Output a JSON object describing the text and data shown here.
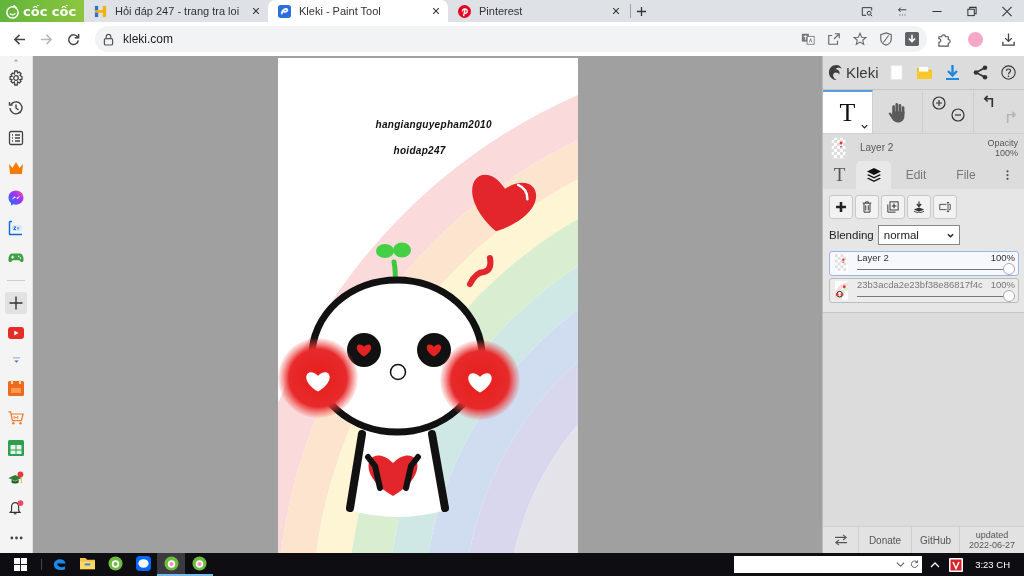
{
  "browser": {
    "logo": "cốc cốc",
    "tabs": [
      {
        "kind": "hoidap",
        "title": "Hỏi đáp 247 - trang tra loi",
        "selected": false
      },
      {
        "kind": "kleki",
        "title": "Kleki - Paint Tool",
        "selected": true
      },
      {
        "kind": "pinterest",
        "title": "Pinterest",
        "selected": false
      }
    ],
    "navigation": [
      {
        "kind": "back",
        "disabled": false
      },
      {
        "kind": "forward",
        "disabled": true
      },
      {
        "kind": "reload",
        "disabled": false
      }
    ],
    "address": "kleki.com"
  },
  "canvas": {
    "texts": [
      "hangianguyepham2010",
      "hoidap247"
    ]
  },
  "kleki": {
    "logo": "Kleki",
    "tools": [
      {
        "kind": "text",
        "label": "T",
        "selected": true
      },
      {
        "kind": "hand",
        "selected": false
      }
    ],
    "history": [
      {
        "kind": "undo",
        "disabled": false
      },
      {
        "kind": "redo",
        "disabled": true
      }
    ],
    "current_layer": {
      "name": "Layer 2",
      "opacity_label": "Opacity",
      "opacity": "100%"
    },
    "panel_tabs": [
      {
        "kind": "text",
        "label": "T",
        "selected": false
      },
      {
        "kind": "layers",
        "selected": true
      },
      {
        "kind": "label",
        "label": "Edit",
        "selected": false
      },
      {
        "kind": "label",
        "label": "File",
        "selected": false
      }
    ],
    "blending": {
      "label": "Blending",
      "value": "normal"
    },
    "layers": [
      {
        "name": "Layer 2",
        "opacity": "100%",
        "level": 1,
        "selected": true
      },
      {
        "name": "23b3acda2e23bf38e86817f4c",
        "opacity": "100%",
        "level": 1,
        "selected": false
      }
    ],
    "footer": {
      "links": [
        "Donate",
        "GitHub"
      ],
      "updated": "updated 2022-06-27"
    }
  },
  "taskbar": {
    "apps": [
      {
        "kind": "edge",
        "running": false,
        "selected": false
      },
      {
        "kind": "folder",
        "running": false,
        "selected": false
      },
      {
        "kind": "globe",
        "running": false,
        "selected": false
      },
      {
        "kind": "chat",
        "running": false,
        "selected": false
      },
      {
        "kind": "globe",
        "running": true,
        "selected": true
      },
      {
        "kind": "globe",
        "running": true,
        "selected": false
      }
    ],
    "clock": "3:23 CH"
  }
}
